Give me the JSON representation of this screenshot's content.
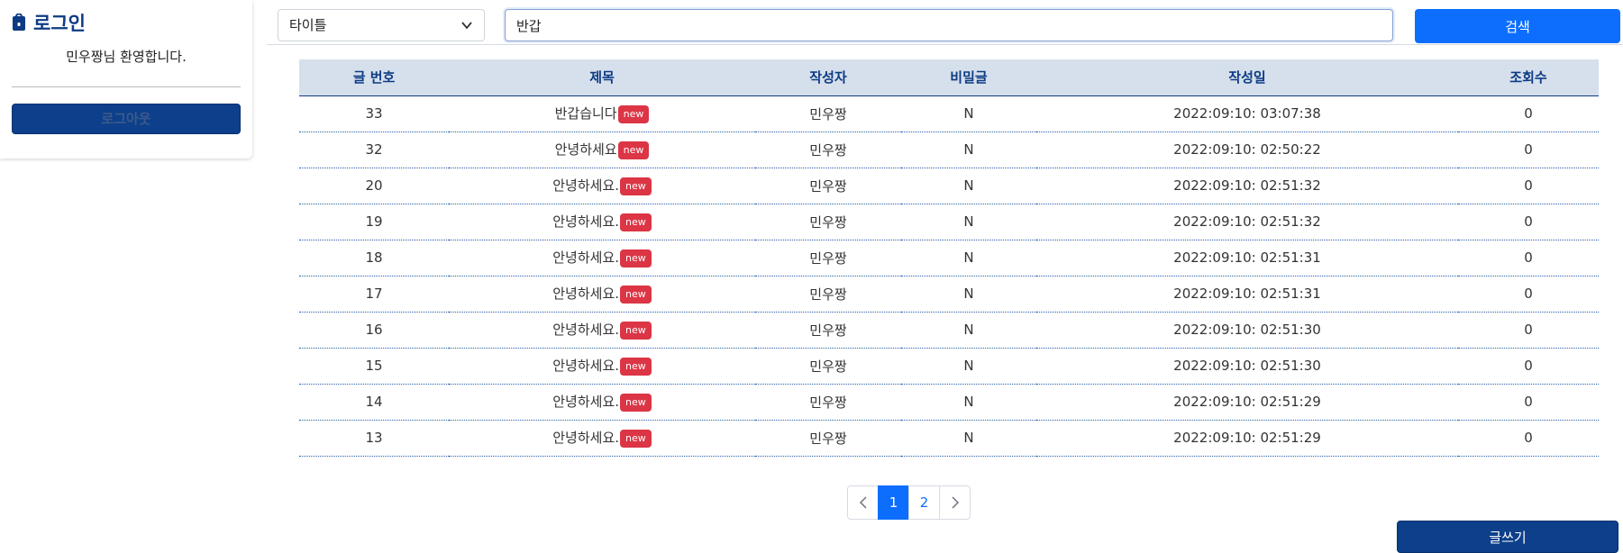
{
  "sidebar": {
    "title": "로그인",
    "welcome": "민우짱님 환영합니다.",
    "logout_label": "로그아웃"
  },
  "search": {
    "select_value": "타이틀",
    "input_value": "반갑",
    "button_label": "검색"
  },
  "table": {
    "headers": {
      "no": "글 번호",
      "title": "제목",
      "writer": "작성자",
      "secret": "비밀글",
      "date": "작성일",
      "views": "조회수"
    },
    "badge_label": "new",
    "rows": [
      {
        "no": "33",
        "title": "반갑습니다",
        "writer": "민우짱",
        "secret": "N",
        "date": "2022:09:10: 03:07:38",
        "views": "0"
      },
      {
        "no": "32",
        "title": "안녕하세요",
        "writer": "민우짱",
        "secret": "N",
        "date": "2022:09:10: 02:50:22",
        "views": "0"
      },
      {
        "no": "20",
        "title": "안녕하세요.",
        "writer": "민우짱",
        "secret": "N",
        "date": "2022:09:10: 02:51:32",
        "views": "0"
      },
      {
        "no": "19",
        "title": "안녕하세요.",
        "writer": "민우짱",
        "secret": "N",
        "date": "2022:09:10: 02:51:32",
        "views": "0"
      },
      {
        "no": "18",
        "title": "안녕하세요.",
        "writer": "민우짱",
        "secret": "N",
        "date": "2022:09:10: 02:51:31",
        "views": "0"
      },
      {
        "no": "17",
        "title": "안녕하세요.",
        "writer": "민우짱",
        "secret": "N",
        "date": "2022:09:10: 02:51:31",
        "views": "0"
      },
      {
        "no": "16",
        "title": "안녕하세요.",
        "writer": "민우짱",
        "secret": "N",
        "date": "2022:09:10: 02:51:30",
        "views": "0"
      },
      {
        "no": "15",
        "title": "안녕하세요.",
        "writer": "민우짱",
        "secret": "N",
        "date": "2022:09:10: 02:51:30",
        "views": "0"
      },
      {
        "no": "14",
        "title": "안녕하세요.",
        "writer": "민우짱",
        "secret": "N",
        "date": "2022:09:10: 02:51:29",
        "views": "0"
      },
      {
        "no": "13",
        "title": "안녕하세요.",
        "writer": "민우짱",
        "secret": "N",
        "date": "2022:09:10: 02:51:29",
        "views": "0"
      }
    ]
  },
  "pagination": {
    "pages": [
      "1",
      "2"
    ],
    "current": "1"
  },
  "write_label": "글쓰기",
  "icons": {
    "lock": "lock-icon",
    "select_arrow": "chevron-down-icon",
    "prev": "chevron-left-icon",
    "next": "chevron-right-icon"
  },
  "colors": {
    "primary": "#0d6efd",
    "navy": "#0d3f8a",
    "header_bg": "#d6e0ec",
    "badge": "#dc3545"
  }
}
